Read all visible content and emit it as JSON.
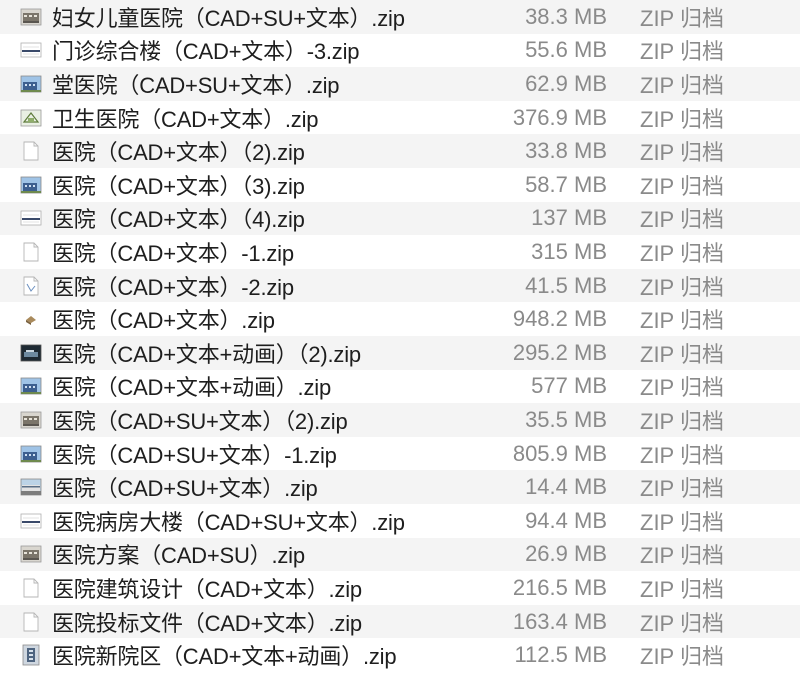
{
  "files": [
    {
      "name": "妇女儿童医院（CAD+SU+文本）.zip",
      "size": "38.3 MB",
      "kind": "ZIP 归档",
      "thumb": "building-photo-icon"
    },
    {
      "name": "门诊综合楼（CAD+文本）-3.zip",
      "size": "55.6 MB",
      "kind": "ZIP 归档",
      "thumb": "drawing-thumbnail-icon"
    },
    {
      "name": "堂医院（CAD+SU+文本）.zip",
      "size": "62.9 MB",
      "kind": "ZIP 归档",
      "thumb": "building-render-icon"
    },
    {
      "name": "卫生医院（CAD+文本）.zip",
      "size": "376.9 MB",
      "kind": "ZIP 归档",
      "thumb": "site-plan-icon"
    },
    {
      "name": "医院（CAD+文本）（2).zip",
      "size": "33.8 MB",
      "kind": "ZIP 归档",
      "thumb": "document-icon"
    },
    {
      "name": "医院（CAD+文本）（3).zip",
      "size": "58.7 MB",
      "kind": "ZIP 归档",
      "thumb": "building-render-icon"
    },
    {
      "name": "医院（CAD+文本）（4).zip",
      "size": "137 MB",
      "kind": "ZIP 归档",
      "thumb": "drawing-thumbnail-icon"
    },
    {
      "name": "医院（CAD+文本）-1.zip",
      "size": "315 MB",
      "kind": "ZIP 归档",
      "thumb": "document-icon"
    },
    {
      "name": "医院（CAD+文本）-2.zip",
      "size": "41.5 MB",
      "kind": "ZIP 归档",
      "thumb": "plan-document-icon"
    },
    {
      "name": "医院（CAD+文本）.zip",
      "size": "948.2 MB",
      "kind": "ZIP 归档",
      "thumb": "model-thumbnail-icon"
    },
    {
      "name": "医院（CAD+文本+动画）（2).zip",
      "size": "295.2 MB",
      "kind": "ZIP 归档",
      "thumb": "dark-render-icon"
    },
    {
      "name": "医院（CAD+文本+动画）.zip",
      "size": "577 MB",
      "kind": "ZIP 归档",
      "thumb": "building-render-icon"
    },
    {
      "name": "医院（CAD+SU+文本）（2).zip",
      "size": "35.5 MB",
      "kind": "ZIP 归档",
      "thumb": "building-photo-icon"
    },
    {
      "name": "医院（CAD+SU+文本）-1.zip",
      "size": "805.9 MB",
      "kind": "ZIP 归档",
      "thumb": "building-render-icon"
    },
    {
      "name": "医院（CAD+SU+文本）.zip",
      "size": "14.4 MB",
      "kind": "ZIP 归档",
      "thumb": "street-render-icon"
    },
    {
      "name": "医院病房大楼（CAD+SU+文本）.zip",
      "size": "94.4 MB",
      "kind": "ZIP 归档",
      "thumb": "drawing-thumbnail-icon"
    },
    {
      "name": "医院方案（CAD+SU）.zip",
      "size": "26.9 MB",
      "kind": "ZIP 归档",
      "thumb": "building-photo-icon"
    },
    {
      "name": "医院建筑设计（CAD+文本）.zip",
      "size": "216.5 MB",
      "kind": "ZIP 归档",
      "thumb": "document-icon"
    },
    {
      "name": "医院投标文件（CAD+文本）.zip",
      "size": "163.4 MB",
      "kind": "ZIP 归档",
      "thumb": "document-icon"
    },
    {
      "name": "医院新院区（CAD+文本+动画）.zip",
      "size": "112.5 MB",
      "kind": "ZIP 归档",
      "thumb": "tower-render-icon"
    }
  ]
}
